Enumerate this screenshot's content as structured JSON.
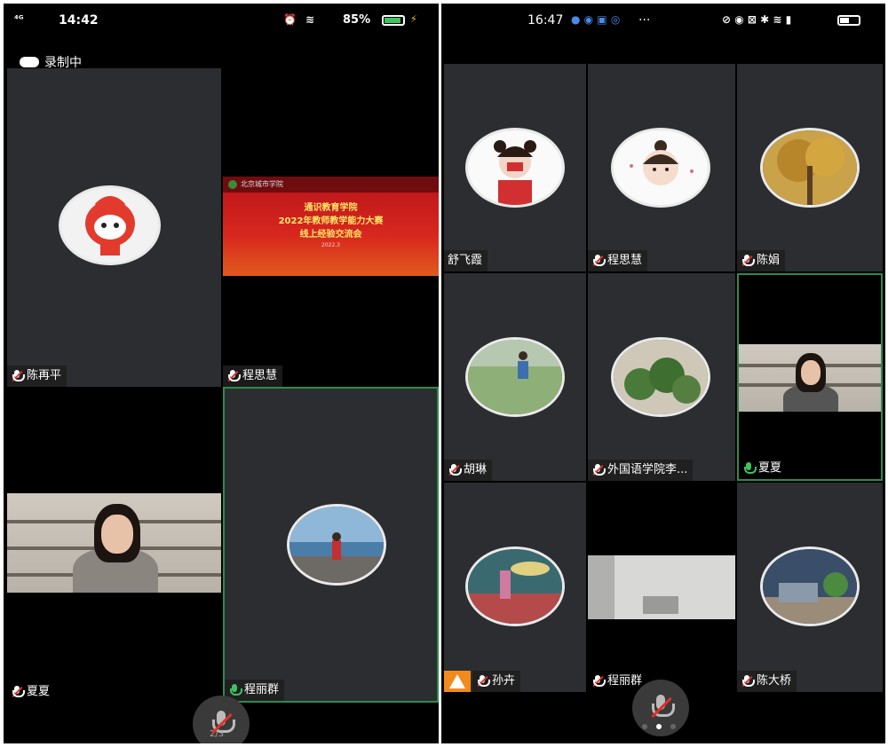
{
  "left_phone": {
    "status": {
      "signal": "⁴ᴳ",
      "time": "14:42",
      "battery_pct": "85%"
    },
    "recording_label": "录制中",
    "slide": {
      "org": "北京城市学院",
      "line1": "通识教育学院",
      "line2": "2022年教师教学能力大赛",
      "line3": "线上经验交流会",
      "date": "2022.3"
    },
    "participants": [
      {
        "name": "陈再平"
      },
      {
        "name": "程思慧"
      },
      {
        "name": "夏夏"
      },
      {
        "name": "程丽群"
      }
    ],
    "pager": "2/3"
  },
  "right_phone": {
    "status": {
      "time": "16:47",
      "more": "···"
    },
    "participants": [
      {
        "name": "舒飞霞"
      },
      {
        "name": "程思慧"
      },
      {
        "name": "陈娟"
      },
      {
        "name": "胡琳"
      },
      {
        "name": "外国语学院李..."
      },
      {
        "name": "夏夏"
      },
      {
        "name": "孙卉"
      },
      {
        "name": "程丽群"
      },
      {
        "name": "陈大桥"
      }
    ]
  },
  "colors": {
    "active_border": "#2e8b4e",
    "tile_bg": "#2b2d30",
    "muted_slash": "#e0302a"
  }
}
